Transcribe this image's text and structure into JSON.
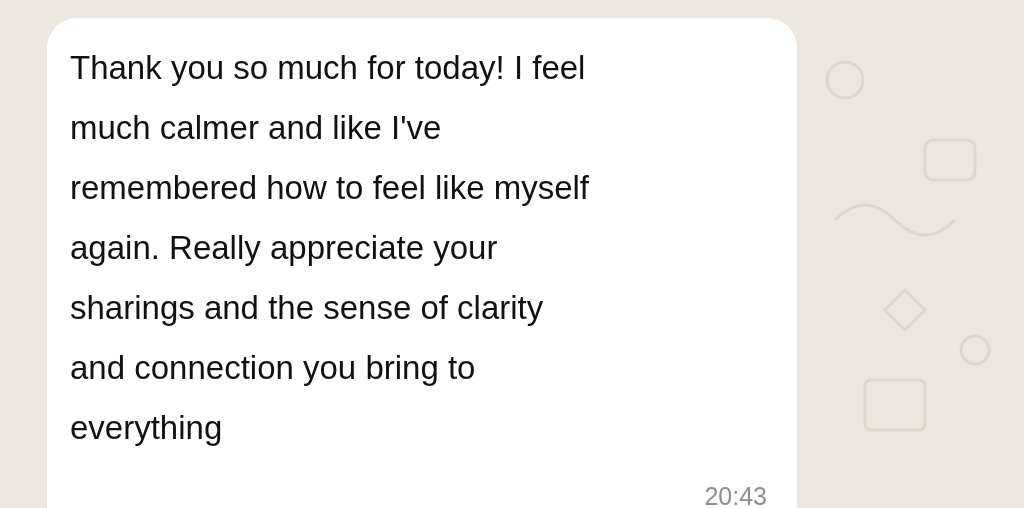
{
  "message": {
    "lines": [
      "Thank you so much for today! I feel",
      "much calmer and like I've",
      "remembered how to feel like myself",
      "again. Really appreciate your",
      "sharings and the sense of clarity",
      "and connection you bring to",
      "everything"
    ],
    "time": "20:43"
  }
}
